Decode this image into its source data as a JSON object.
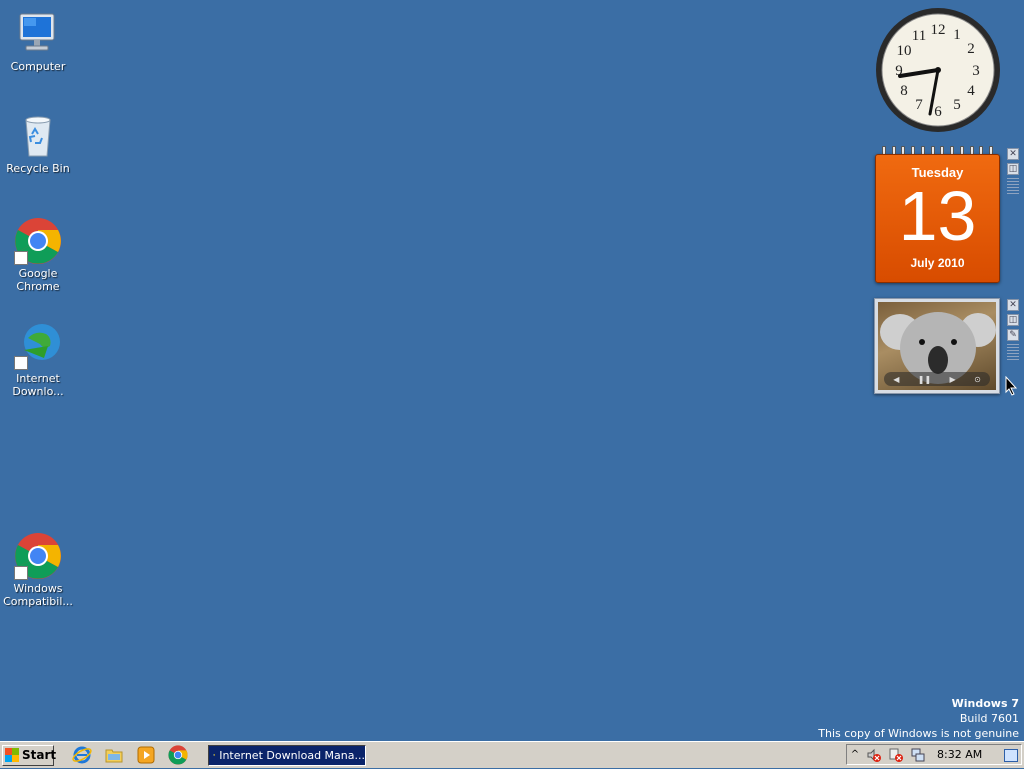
{
  "desktop": {
    "background_color": "#3b6ea5",
    "icons": [
      {
        "label": "Computer",
        "icon": "computer-icon"
      },
      {
        "label": "Recycle Bin",
        "icon": "recycle-bin-icon"
      },
      {
        "label": "Google Chrome",
        "icon": "chrome-icon"
      },
      {
        "label": "Internet\nDownlo...",
        "icon": "internet-download-manager-icon"
      },
      {
        "label": "Windows\nCompatibil...",
        "icon": "chrome-icon"
      }
    ]
  },
  "gadgets": {
    "clock": {
      "numbers": [
        "12",
        "1",
        "2",
        "3",
        "4",
        "5",
        "6",
        "7",
        "8",
        "9",
        "10",
        "11"
      ],
      "time": "8:32"
    },
    "calendar": {
      "weekday": "Tuesday",
      "day": "13",
      "month_year": "July 2010",
      "color": "#e85c06"
    },
    "slideshow": {
      "subject": "koala-photo"
    }
  },
  "watermark": {
    "line1": "Windows 7",
    "line2": "Build 7601",
    "line3": "This copy of Windows is not genuine"
  },
  "taskbar": {
    "start_label": "Start",
    "quick_launch": [
      "internet-explorer-icon",
      "explorer-folder-icon",
      "media-player-icon",
      "chrome-icon"
    ],
    "task_button_label": "Internet Download Mana...",
    "tray": {
      "expand_glyph": "^",
      "clock": "8:32 AM"
    }
  }
}
